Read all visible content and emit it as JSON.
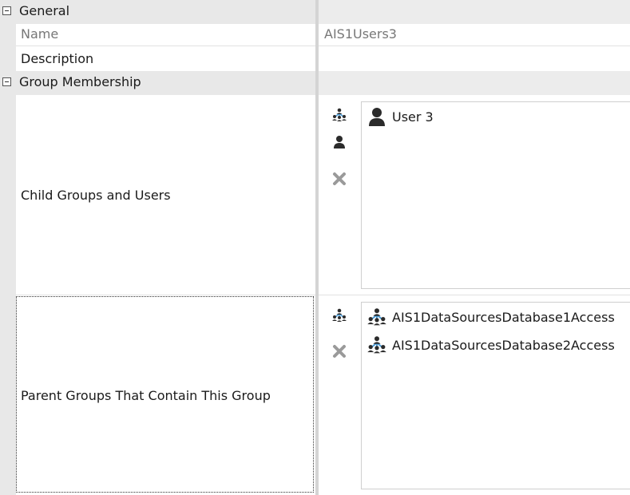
{
  "categories": {
    "general": {
      "label": "General"
    },
    "membership": {
      "label": "Group Membership"
    }
  },
  "properties": {
    "name": {
      "label": "Name",
      "value": "AIS1Users3"
    },
    "description": {
      "label": "Description",
      "value": ""
    },
    "child": {
      "label": "Child Groups and Users"
    },
    "parent": {
      "label": "Parent Groups That Contain This Group"
    }
  },
  "child_items": [
    {
      "label": "User 3",
      "icon": "user-icon"
    }
  ],
  "parent_items": [
    {
      "label": "AIS1DataSourcesDatabase1Access",
      "icon": "group-icon"
    },
    {
      "label": "AIS1DataSourcesDatabase2Access",
      "icon": "group-icon"
    }
  ],
  "icons": {
    "add_group": "group-add-icon",
    "add_user": "user-add-icon",
    "remove": "remove-icon"
  },
  "colors": {
    "category_bg": "#e8e8e8",
    "icon_dark": "#2b2b2b",
    "icon_blue": "#4a9bd6",
    "remove_gray": "#9a9a9a"
  }
}
